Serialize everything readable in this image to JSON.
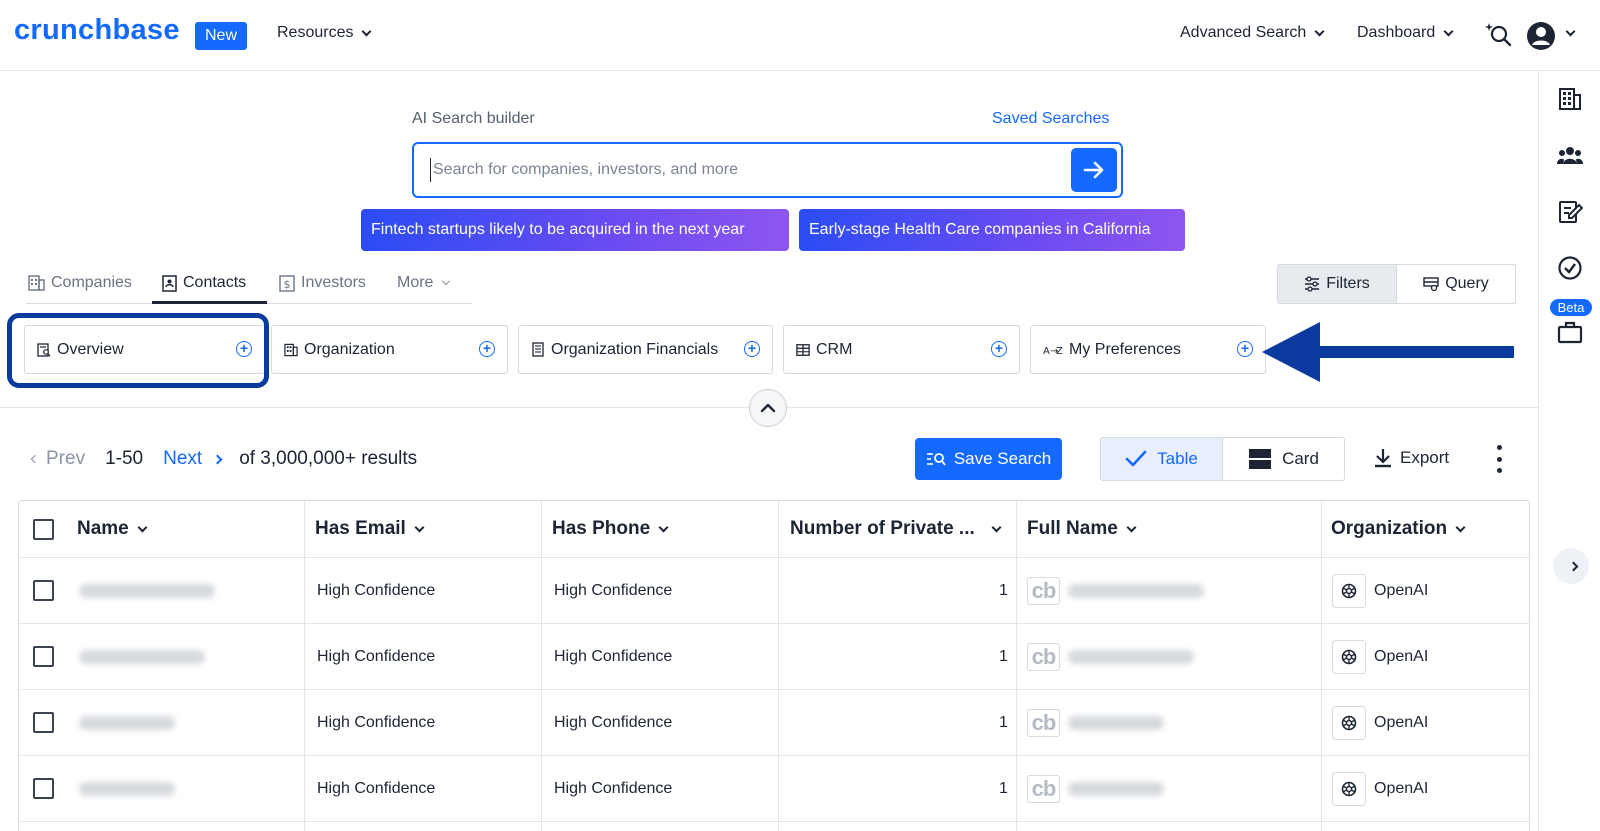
{
  "header": {
    "logo": "crunchbase",
    "new_badge": "New",
    "resources": "Resources",
    "advanced_search": "Advanced Search",
    "dashboard": "Dashboard"
  },
  "ai_search": {
    "label": "AI Search builder",
    "saved_searches": "Saved Searches",
    "placeholder": "Search for companies, investors, and more",
    "suggestions": [
      "Fintech startups likely to be acquired in the next year",
      "Early-stage Health Care companies in California"
    ]
  },
  "entity_tabs": [
    {
      "label": "Companies",
      "icon": "building-icon"
    },
    {
      "label": "Contacts",
      "icon": "contact-card-icon",
      "active": true
    },
    {
      "label": "Investors",
      "icon": "dollar-icon"
    },
    {
      "label": "More",
      "icon": "chevron-down-icon"
    }
  ],
  "filter_query": {
    "filters": "Filters",
    "query": "Query"
  },
  "sections": [
    {
      "label": "Overview",
      "icon": "overview-icon"
    },
    {
      "label": "Organization",
      "icon": "building-icon"
    },
    {
      "label": "Organization Financials",
      "icon": "document-icon"
    },
    {
      "label": "CRM",
      "icon": "table-icon"
    },
    {
      "label": "My Preferences",
      "icon": "az-sort-icon"
    }
  ],
  "rail": {
    "beta": "Beta"
  },
  "results": {
    "prev": "Prev",
    "range": "1-50",
    "next": "Next",
    "total": "of 3,000,000+ results",
    "save_search": "Save Search",
    "table": "Table",
    "card": "Card",
    "export": "Export"
  },
  "table": {
    "columns": [
      "Name",
      "Has Email",
      "Has Phone",
      "Number of Private ...",
      "Full Name",
      "Organization"
    ],
    "rows": [
      {
        "has_email": "High Confidence",
        "has_phone": "High Confidence",
        "private_count": "1",
        "cb": "cb",
        "organization": "OpenAI"
      },
      {
        "has_email": "High Confidence",
        "has_phone": "High Confidence",
        "private_count": "1",
        "cb": "cb",
        "organization": "OpenAI"
      },
      {
        "has_email": "High Confidence",
        "has_phone": "High Confidence",
        "private_count": "1",
        "cb": "cb",
        "organization": "OpenAI"
      },
      {
        "has_email": "High Confidence",
        "has_phone": "High Confidence",
        "private_count": "1",
        "cb": "cb",
        "organization": "OpenAI"
      }
    ]
  },
  "colors": {
    "brand": "#146aff",
    "highlight": "#0b3a9e"
  }
}
